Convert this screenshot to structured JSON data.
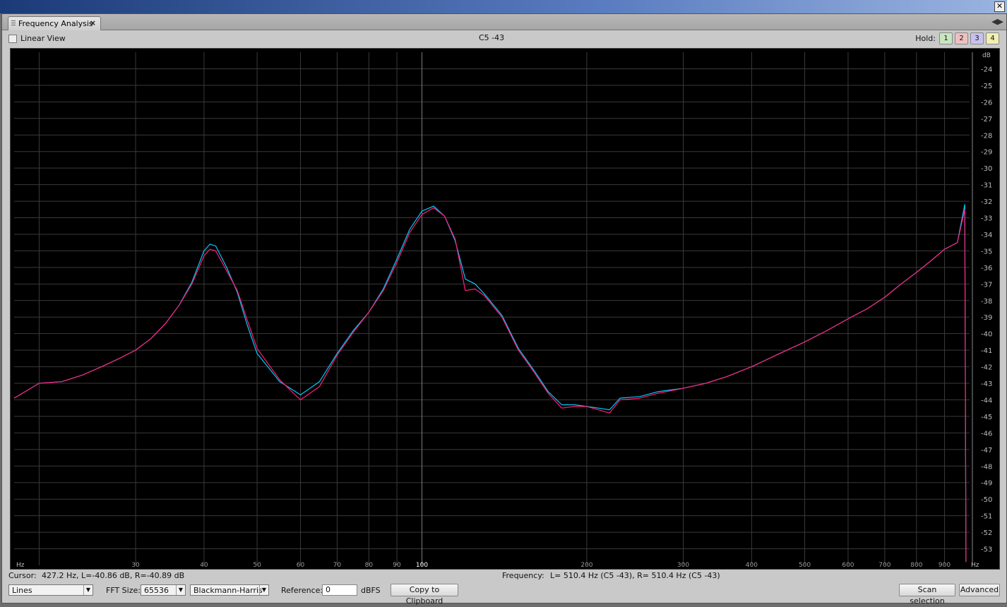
{
  "window": {
    "close_glyph": "✕"
  },
  "tab": {
    "label": "Frequency Analysis",
    "close": "×",
    "menu_glyph": "◀▶"
  },
  "options": {
    "linear_view": "Linear View",
    "center_title": "C5 -43",
    "hold_label": "Hold:",
    "hold_buttons": [
      "1",
      "2",
      "3",
      "4"
    ],
    "hold_colors": [
      "#c8e6c0",
      "#f0c0c0",
      "#c8c0f0",
      "#f0f0b0"
    ]
  },
  "chart_data": {
    "type": "line",
    "xscale": "log",
    "xlim": [
      18,
      1000
    ],
    "ylim": [
      -54,
      -23
    ],
    "grid": true,
    "xlabel": "Hz",
    "ylabel": "dB",
    "x_ticks": [
      30,
      40,
      50,
      60,
      70,
      80,
      90,
      100,
      200,
      300,
      400,
      500,
      600,
      700,
      800,
      900
    ],
    "y_ticks": [
      -24,
      -25,
      -26,
      -27,
      -28,
      -29,
      -30,
      -31,
      -32,
      -33,
      -34,
      -35,
      -36,
      -37,
      -38,
      -39,
      -40,
      -41,
      -42,
      -43,
      -44,
      -45,
      -46,
      -47,
      -48,
      -49,
      -50,
      -51,
      -52,
      -53
    ],
    "series": [
      {
        "color": "#00c8ff",
        "x": [
          18,
          20,
          22,
          24,
          26,
          28,
          30,
          32,
          34,
          36,
          38,
          40,
          41,
          42,
          44,
          46,
          48,
          50,
          55,
          60,
          65,
          70,
          75,
          80,
          85,
          90,
          95,
          100,
          105,
          110,
          115,
          120,
          125,
          130,
          140,
          150,
          160,
          170,
          180,
          190,
          200,
          210,
          220,
          230,
          250,
          270,
          300,
          330,
          360,
          400,
          450,
          500,
          550,
          600,
          650,
          700,
          750,
          800,
          850,
          900,
          950,
          980
        ],
        "y": [
          -43.9,
          -43.0,
          -42.9,
          -42.5,
          -42.0,
          -41.5,
          -41.0,
          -40.3,
          -39.4,
          -38.3,
          -36.9,
          -35.0,
          -34.6,
          -34.7,
          -36.0,
          -37.5,
          -39.5,
          -41.2,
          -42.9,
          -43.7,
          -42.9,
          -41.2,
          -39.8,
          -38.7,
          -37.3,
          -35.5,
          -33.7,
          -32.6,
          -32.3,
          -32.9,
          -34.4,
          -36.7,
          -37.0,
          -37.6,
          -38.9,
          -40.9,
          -42.2,
          -43.5,
          -44.3,
          -44.3,
          -44.4,
          -44.5,
          -44.6,
          -43.9,
          -43.8,
          -43.5,
          -43.3,
          -43.0,
          -42.6,
          -42.0,
          -41.2,
          -40.5,
          -39.8,
          -39.1,
          -38.5,
          -37.8,
          -37.0,
          -36.3,
          -35.6,
          -34.9,
          -34.5,
          -32.2
        ]
      },
      {
        "color": "#ff1f7a",
        "x": [
          18,
          20,
          22,
          24,
          26,
          28,
          30,
          32,
          34,
          36,
          38,
          40,
          41,
          42,
          44,
          46,
          48,
          50,
          55,
          60,
          65,
          70,
          75,
          80,
          85,
          90,
          95,
          100,
          105,
          110,
          115,
          120,
          125,
          130,
          140,
          150,
          160,
          170,
          180,
          190,
          200,
          210,
          220,
          230,
          250,
          270,
          300,
          330,
          360,
          400,
          450,
          500,
          550,
          600,
          650,
          700,
          750,
          800,
          850,
          900,
          950,
          980
        ],
        "y": [
          -43.9,
          -43.0,
          -42.9,
          -42.5,
          -42.0,
          -41.5,
          -41.0,
          -40.3,
          -39.4,
          -38.3,
          -37.0,
          -35.3,
          -34.9,
          -35.0,
          -36.2,
          -37.4,
          -39.2,
          -40.9,
          -42.8,
          -44.0,
          -43.2,
          -41.3,
          -39.9,
          -38.7,
          -37.4,
          -35.7,
          -33.9,
          -32.8,
          -32.4,
          -32.9,
          -34.3,
          -37.4,
          -37.3,
          -37.7,
          -39.0,
          -41.0,
          -42.3,
          -43.6,
          -44.5,
          -44.4,
          -44.4,
          -44.6,
          -44.8,
          -44.0,
          -43.9,
          -43.6,
          -43.3,
          -43.0,
          -42.6,
          -42.0,
          -41.2,
          -40.5,
          -39.8,
          -39.1,
          -38.5,
          -37.8,
          -37.0,
          -36.3,
          -35.6,
          -34.9,
          -34.5,
          -32.5
        ]
      }
    ]
  },
  "status": {
    "cursor_label": "Cursor:",
    "cursor_value": "427.2 Hz, L=-40.86 dB, R=-40.89 dB",
    "frequency_label": "Frequency:",
    "frequency_value": "L=  510.4 Hz (C5 -43), R=  510.4 Hz (C5 -43)"
  },
  "controls": {
    "display_mode": "Lines",
    "fft_label": "FFT Size:",
    "fft_size": "65536",
    "window": "Blackmann-Harris",
    "reference_label": "Reference:",
    "reference_value": "0",
    "reference_unit": "dBFS",
    "copy_button": "Copy to Clipboard",
    "scan_button": "Scan selection",
    "advanced_button": "Advanced"
  }
}
